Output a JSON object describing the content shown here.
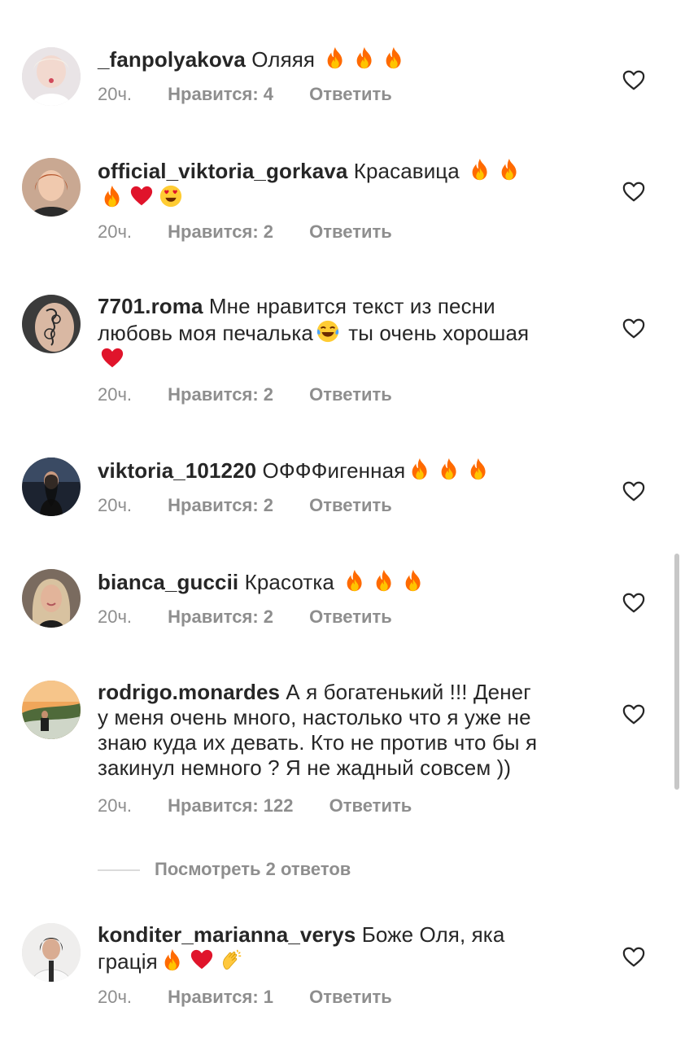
{
  "comments": [
    {
      "username": "_fanpolyakova",
      "text": "Оляяя",
      "emoji": [
        "fire",
        "fire",
        "fire"
      ],
      "time": "20ч.",
      "likes": "Нравится: 4",
      "reply": "Ответить"
    },
    {
      "username": "official_viktoria_gorkava",
      "text": "Красавица",
      "emoji": [
        "fire",
        "fire",
        "fire",
        "red-heart",
        "heart-eyes"
      ],
      "time": "20ч.",
      "likes": "Нравится: 2",
      "reply": "Ответить"
    },
    {
      "username": "7701.roma",
      "text_1": "Мне нравится текст из песни",
      "text_2": "любовь моя печалька",
      "text_3": "ты очень хорошая",
      "emoji": [
        "joy",
        "red-heart"
      ],
      "time": "20ч.",
      "likes": "Нравится: 2",
      "reply": "Ответить"
    },
    {
      "username": "viktoria_101220",
      "text": "ОФФФигенная",
      "emoji": [
        "fire",
        "fire",
        "fire"
      ],
      "time": "20ч.",
      "likes": "Нравится: 2",
      "reply": "Ответить"
    },
    {
      "username": "bianca_guccii",
      "text": "Красотка",
      "emoji": [
        "fire",
        "fire",
        "fire"
      ],
      "time": "20ч.",
      "likes": "Нравится: 2",
      "reply": "Ответить"
    },
    {
      "username": "rodrigo.monardes",
      "text_1": "А я богатенький !!! Денег",
      "text_2": "у меня очень много, настолько что я уже не",
      "text_3": "знаю куда их девать. Кто не против что бы я",
      "text_4": "закинул немного ? Я не жадный совсем ))",
      "time": "20ч.",
      "likes": "Нравится: 122",
      "reply": "Ответить",
      "view_replies": "Посмотреть 2 ответов"
    },
    {
      "username": "konditer_marianna_verys",
      "text_1": "Боже Оля, яка",
      "text_2": "грація",
      "emoji": [
        "fire",
        "red-heart",
        "clapping-hands"
      ],
      "time": "20ч.",
      "likes": "Нравится: 1",
      "reply": "Ответить"
    }
  ],
  "colors": {
    "text": "#262626",
    "secondary": "#8e8e8e",
    "fire": "#ff7a00",
    "heart": "#e0142b"
  }
}
